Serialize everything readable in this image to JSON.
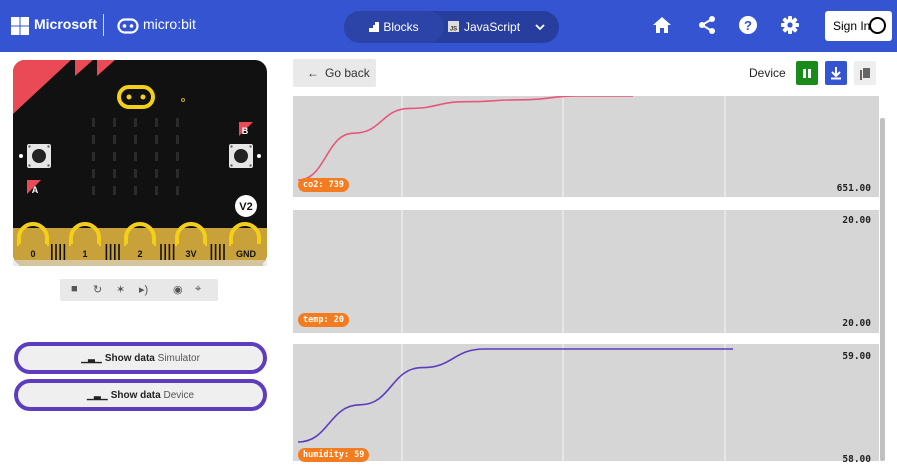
{
  "header": {
    "brand": "Microsoft",
    "product": "micro:bit",
    "tabs": [
      {
        "label": "Blocks",
        "icon": "blocks-icon",
        "active": true
      },
      {
        "label": "JavaScript",
        "icon": "javascript-icon",
        "active": false
      }
    ],
    "icons": [
      "home-icon",
      "share-icon",
      "help-icon",
      "settings-icon"
    ],
    "sign_in": "Sign In"
  },
  "simulator": {
    "pins": [
      "0",
      "1",
      "2",
      "3V",
      "GND"
    ],
    "buttons": [
      "A",
      "B"
    ],
    "version_badge": "V2",
    "tools": [
      "stop-icon",
      "restart-icon",
      "debug-icon",
      "mute-icon",
      "screenshot-icon",
      "fullscreen-icon"
    ]
  },
  "show_data": [
    {
      "label": "Show data",
      "source": "Simulator"
    },
    {
      "label": "Show data",
      "source": "Device"
    }
  ],
  "console": {
    "go_back": "Go back",
    "mode_label": "Device",
    "toolbar": [
      "pause-icon",
      "download-icon",
      "copy-icon"
    ],
    "colors": {
      "pill": "#f47c20",
      "co2_line": "#e8567c",
      "humidity_line": "#5c3dbd",
      "pause": "#1a8a1a",
      "download": "#3454d1"
    }
  },
  "chart_data": [
    {
      "type": "line",
      "series": [
        {
          "name": "co2",
          "values": [
            651,
            700,
            726,
            733,
            735,
            739,
            739
          ]
        }
      ],
      "latest_label": "co2: 739",
      "value_labels": [
        "651.00"
      ]
    },
    {
      "type": "line",
      "series": [
        {
          "name": "temp",
          "values": [
            20,
            20,
            20,
            20,
            20
          ]
        }
      ],
      "latest_label": "temp: 20",
      "value_labels": [
        "20.00",
        "20.00"
      ]
    },
    {
      "type": "line",
      "series": [
        {
          "name": "humidity",
          "values": [
            58,
            58.4,
            58.8,
            59,
            59,
            59,
            59,
            59
          ]
        }
      ],
      "latest_label": "humidity: 59",
      "value_labels": [
        "59.00",
        "58.00"
      ]
    }
  ]
}
